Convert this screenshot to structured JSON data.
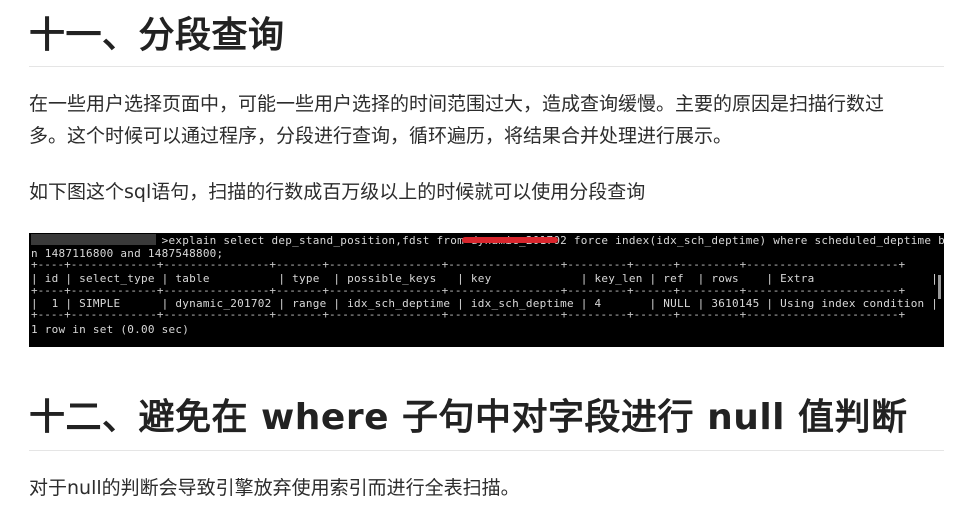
{
  "section11": {
    "heading": "十一、分段查询",
    "para1_line1": "在一些用户选择页面中，可能一些用户选择的时间范围过大，造成查询缓慢。主要的原因是扫描行数过",
    "para1_line2": "多。这个时候可以通过程序，分段进行查询，循环遍历，将结果合并处理进行展示。",
    "para2": "如下图这个sql语句，扫描的行数成百万级以上的时候就可以使用分段查询"
  },
  "terminal": {
    "cmd_line1": "                   >explain select dep_stand_position,fdst from dynamic_201702 force index(idx_sch_deptime) where scheduled_deptime betwee",
    "cmd_line2": "n 1487116800 and 1487548800;",
    "border_top": "+----+-------------+----------------+-------+-----------------+-----------------+---------+------+---------+-----------------------+",
    "header_row": "| id | select_type | table          | type  | possible_keys   | key             | key_len | ref  | rows    | Extra                 |",
    "border_mid": "+----+-------------+----------------+-------+-----------------+-----------------+---------+------+---------+-----------------------+",
    "data_row": "|  1 | SIMPLE      | dynamic_201702 | range | idx_sch_deptime | idx_sch_deptime | 4       | NULL | 3610145 | Using index condition |",
    "border_bottom": "+----+-------------+----------------+-------+-----------------+-----------------+---------+------+---------+-----------------------+",
    "footer": "1 row in set (0.00 sec)"
  },
  "section12": {
    "heading": "十二、避免在 where 子句中对字段进行 null 值判断",
    "para1": "对于null的判断会导致引擎放弃使用索引而进行全表扫描。"
  }
}
